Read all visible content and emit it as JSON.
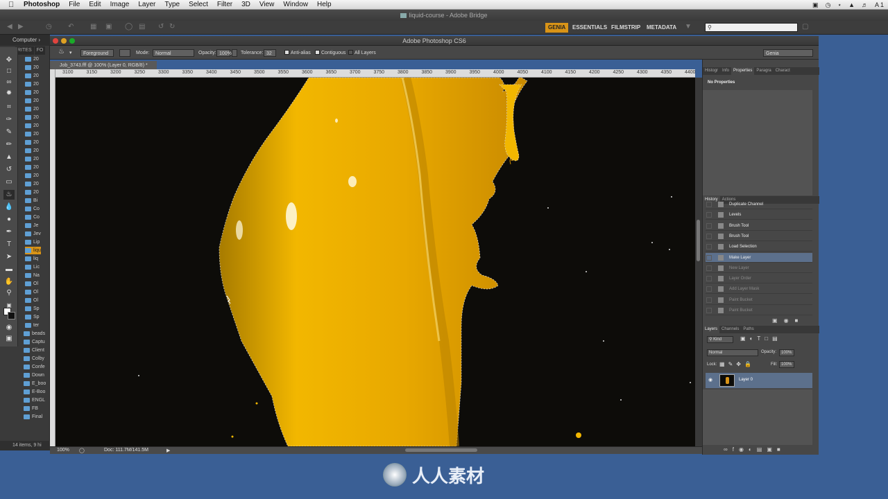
{
  "menubar": {
    "app": "Photoshop",
    "items": [
      "File",
      "Edit",
      "Image",
      "Layer",
      "Type",
      "Select",
      "Filter",
      "3D",
      "View",
      "Window",
      "Help"
    ],
    "right_text": "A 1"
  },
  "bridge": {
    "title": "liquid-course - Adobe Bridge",
    "workspaces": [
      "GENIA",
      "ESSENTIALS",
      "FILMSTRIP",
      "METADATA"
    ],
    "active_workspace": "GENIA",
    "search_placeholder": "",
    "path_label": "Computer",
    "panel_tabs": [
      "RITES",
      "FO"
    ],
    "folders": [
      "20",
      "20",
      "20",
      "20",
      "20",
      "20",
      "20",
      "20",
      "20",
      "20",
      "20",
      "20",
      "20",
      "20",
      "20",
      "20",
      "20",
      "Bi",
      "Co",
      "Co",
      "Je",
      "Jev",
      "Lip",
      "liqu",
      "liq",
      "Lic",
      "Na",
      "Ol",
      "Ol",
      "Ol",
      "Sp",
      "Sp",
      "ter",
      "beads",
      "Captu",
      "Client",
      "Colby",
      "Confe",
      "Down",
      "E_boo",
      "E-Boo",
      "ENGL",
      "FB",
      "Final"
    ],
    "selected_folder_index": 23,
    "status": "14 items, 9 hi"
  },
  "photoshop": {
    "title": "Adobe Photoshop CS6",
    "options": {
      "fill_source": "Foreground",
      "mode_label": "Mode:",
      "mode_value": "Normal",
      "opacity_label": "Opacity:",
      "opacity_value": "100%",
      "tolerance_label": "Tolerance:",
      "tolerance_value": "32",
      "antialias": "Anti-alias",
      "contiguous": "Contiguous",
      "all_layers": "All Layers",
      "workspace": "Genia"
    },
    "doc_tab": "Job_3743.fff @ 100% (Layer 0, RGB/8) *",
    "ruler_ticks": [
      "3100",
      "3150",
      "3200",
      "3250",
      "3300",
      "3350",
      "3400",
      "3450",
      "3500",
      "3550",
      "3600",
      "3650",
      "3700",
      "3750",
      "3800",
      "3850",
      "3900",
      "3950",
      "4000",
      "4050",
      "4100",
      "4150",
      "4200",
      "4250",
      "4300",
      "4350",
      "4400"
    ],
    "zoom": "100%",
    "doc_size": "Doc: 111.7M/141.5M"
  },
  "panels": {
    "top_tabs": [
      "Histogr",
      "Info",
      "Properties",
      "Paragra",
      "Charact"
    ],
    "top_active": "Properties",
    "properties_text": "No Properties",
    "history_tabs": [
      "History",
      "Actions"
    ],
    "history_items": [
      {
        "label": "Duplicate Channel",
        "state": "normal"
      },
      {
        "label": "Levels",
        "state": "normal"
      },
      {
        "label": "Brush Tool",
        "state": "normal"
      },
      {
        "label": "Brush Tool",
        "state": "normal"
      },
      {
        "label": "Load Selection",
        "state": "normal"
      },
      {
        "label": "Make Layer",
        "state": "current"
      },
      {
        "label": "New Layer",
        "state": "dim"
      },
      {
        "label": "Layer Order",
        "state": "dim"
      },
      {
        "label": "Add Layer Mask",
        "state": "dim"
      },
      {
        "label": "Paint Bucket",
        "state": "dim"
      },
      {
        "label": "Paint Bucket",
        "state": "dim"
      }
    ],
    "layers_tabs": [
      "Layers",
      "Channels",
      "Paths"
    ],
    "kind_label": "Kind",
    "blend_mode": "Normal",
    "opacity_label": "Opacity:",
    "opacity_value": "100%",
    "lock_label": "Lock:",
    "fill_label": "Fill:",
    "fill_value": "100%",
    "layer_name": "Layer 0"
  },
  "footer_logo": "人人素材",
  "colors": {
    "accent": "#d99417",
    "selection": "#5c708c",
    "paint": "#f2b700"
  }
}
